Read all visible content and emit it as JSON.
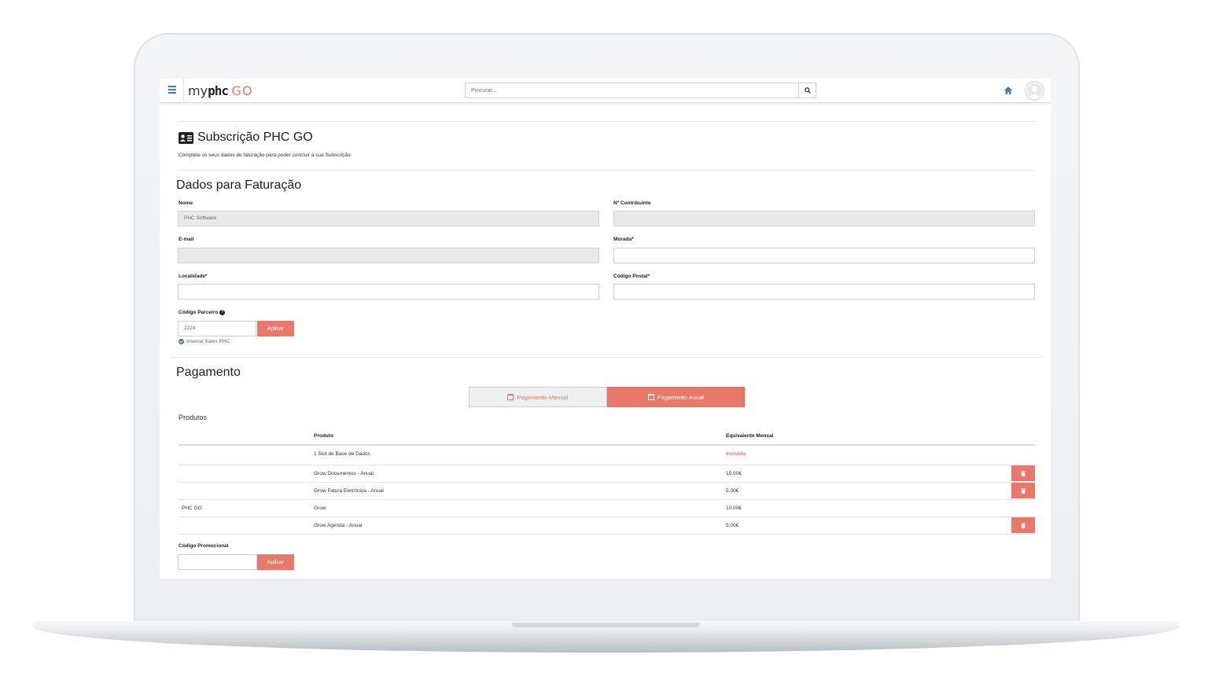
{
  "navbar": {
    "logo_my": "my",
    "logo_phc": "phc",
    "logo_go": "GO",
    "search_placeholder": "Procurar..."
  },
  "page": {
    "title": "Subscrição PHC GO",
    "subtitle": "Complete os seus dados de faturação para poder concluir a sua Subscrição"
  },
  "billing": {
    "title": "Dados para Faturação",
    "nome_label": "Nome",
    "nome_value": "PHC Software",
    "contribuinte_label": "Nº Contribuinte",
    "contribuinte_value": "",
    "email_label": "E-mail",
    "email_value": "",
    "morada_label": "Morada*",
    "morada_value": "",
    "localidade_label": "Localidade*",
    "localidade_value": "",
    "codigo_postal_label": "Código Postal*",
    "codigo_postal_value": "",
    "parceiro_label": "Código Parceiro",
    "parceiro_value": "2224",
    "apply_label": "Aplicar",
    "parceiro_status": "Internal Sales PHC"
  },
  "payment": {
    "title": "Pagamento",
    "monthly_label": "Pagamento Mensal",
    "annual_label": "Pagamento Anual",
    "selected": "annual"
  },
  "products": {
    "label": "Produtos",
    "headers": [
      "Produto",
      "Equivalente Mensal"
    ],
    "rows": [
      {
        "group": "",
        "product": "1 Slot de Base de Dados",
        "price": "Incluído",
        "deletable": false
      },
      {
        "group": "",
        "product": "Grow Documentos - Anual",
        "price": "15.00€",
        "deletable": true
      },
      {
        "group": "",
        "product": "Grow Fatura Eletrónica - Anual",
        "price": "5.00€",
        "deletable": true
      },
      {
        "group": "PHC GO",
        "product": "Grow",
        "price": "10.00€",
        "deletable": false
      },
      {
        "group": "",
        "product": "Grow Agenda - Anual",
        "price": "5.00€",
        "deletable": true
      }
    ]
  },
  "promo": {
    "label": "Código Promocional",
    "value": "",
    "apply_label": "Aplicar"
  },
  "colors": {
    "accent": "#e8796a",
    "link_blue": "#3d7cc9",
    "success": "#3c8a3c"
  }
}
